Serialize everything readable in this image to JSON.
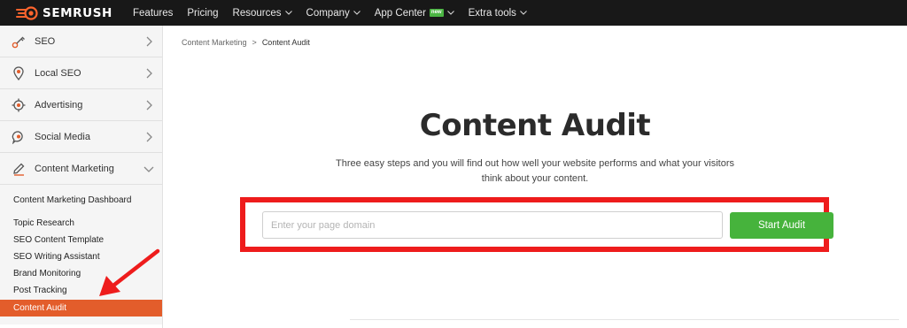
{
  "brand": {
    "name": "SEMRUSH",
    "accent": "#ff642d"
  },
  "nav": {
    "items": [
      {
        "label": "Features",
        "dropdown": false
      },
      {
        "label": "Pricing",
        "dropdown": false
      },
      {
        "label": "Resources",
        "dropdown": true
      },
      {
        "label": "Company",
        "dropdown": true
      },
      {
        "label": "App Center",
        "dropdown": true,
        "badge": "new"
      },
      {
        "label": "Extra tools",
        "dropdown": true
      }
    ]
  },
  "sidebar": {
    "sections": [
      {
        "label": "SEO",
        "icon": "seo-key-icon"
      },
      {
        "label": "Local SEO",
        "icon": "location-pin-icon"
      },
      {
        "label": "Advertising",
        "icon": "target-icon"
      },
      {
        "label": "Social Media",
        "icon": "chat-bubble-icon"
      },
      {
        "label": "Content Marketing",
        "icon": "pencil-icon",
        "expanded": true
      }
    ],
    "sub_items": [
      {
        "label": "Content Marketing Dashboard"
      },
      {
        "label": "Topic Research"
      },
      {
        "label": "SEO Content Template"
      },
      {
        "label": "SEO Writing Assistant"
      },
      {
        "label": "Brand Monitoring"
      },
      {
        "label": "Post Tracking"
      },
      {
        "label": "Content Audit",
        "active": true
      }
    ],
    "active_color": "#e35d2b"
  },
  "breadcrumb": {
    "parent": "Content Marketing",
    "separator": ">",
    "current": "Content Audit"
  },
  "main": {
    "title": "Content Audit",
    "subtitle": "Three easy steps and you will find out how well your website performs and what your visitors think about your content.",
    "input_placeholder": "Enter your page domain",
    "input_value": "",
    "button_label": "Start Audit",
    "button_color": "#46b33c",
    "highlight_color": "#ee1c1c"
  }
}
